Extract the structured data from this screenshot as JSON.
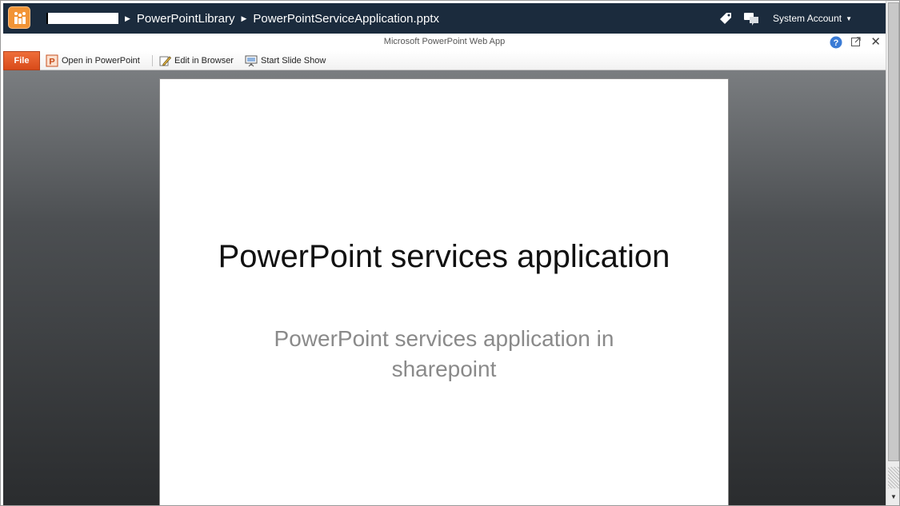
{
  "breadcrumb": {
    "library": "PowerPointLibrary",
    "file": "PowerPointServiceApplication.pptx"
  },
  "user": {
    "account": "System Account"
  },
  "app_bar": {
    "title": "Microsoft PowerPoint Web App"
  },
  "ribbon": {
    "file_tab": "File",
    "open_in_powerpoint": "Open in PowerPoint",
    "edit_in_browser": "Edit in Browser",
    "start_slide_show": "Start Slide Show"
  },
  "slide": {
    "title": "PowerPoint services application",
    "subtitle": "PowerPoint services application in sharepoint"
  },
  "icons": {
    "logo": "sharepoint-logo-icon",
    "tag": "tag-icon",
    "social": "social-notes-icon",
    "help": "help-icon",
    "popout": "popout-icon",
    "close": "close-icon"
  },
  "colors": {
    "topbar": "#1b2b3d",
    "logo": "#f29436",
    "file_tab": "#e35d28",
    "help": "#3a7bd5"
  }
}
